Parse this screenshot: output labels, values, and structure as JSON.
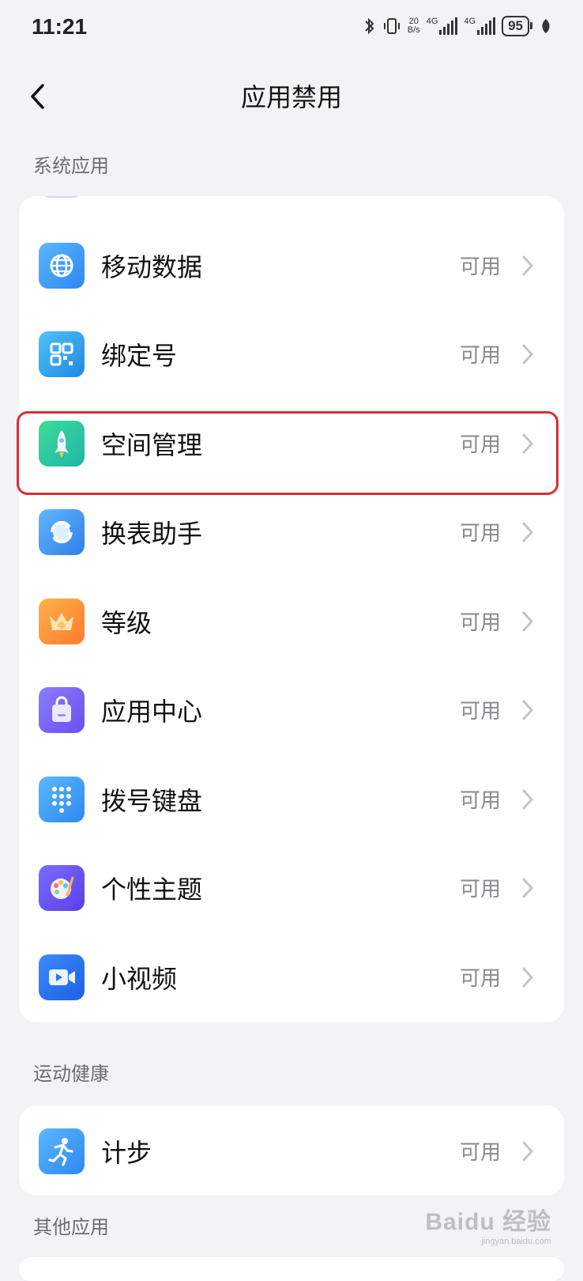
{
  "status_bar": {
    "time": "11:21",
    "net_speed_value": "20",
    "net_speed_unit": "B/s",
    "sim1_label": "4G",
    "sim2_label": "4G",
    "battery": "95"
  },
  "header": {
    "title": "应用禁用"
  },
  "sections": {
    "system": "系统应用",
    "sports": "运动健康",
    "other": "其他应用"
  },
  "system_apps": [
    {
      "label": "移动数据",
      "status": "可用",
      "icon": "globe-icon"
    },
    {
      "label": "绑定号",
      "status": "可用",
      "icon": "qr-code-icon"
    },
    {
      "label": "空间管理",
      "status": "可用",
      "icon": "rocket-icon"
    },
    {
      "label": "换表助手",
      "status": "可用",
      "icon": "sync-icon"
    },
    {
      "label": "等级",
      "status": "可用",
      "icon": "crown-icon"
    },
    {
      "label": "应用中心",
      "status": "可用",
      "icon": "shopping-bag-icon"
    },
    {
      "label": "拨号键盘",
      "status": "可用",
      "icon": "dialpad-icon"
    },
    {
      "label": "个性主题",
      "status": "可用",
      "icon": "palette-icon"
    },
    {
      "label": "小视频",
      "status": "可用",
      "icon": "video-icon"
    }
  ],
  "sports_apps": [
    {
      "label": "计步",
      "status": "可用",
      "icon": "running-icon"
    }
  ],
  "watermark": {
    "brand": "Baidu 经验",
    "url": "jingyan.baidu.com"
  }
}
